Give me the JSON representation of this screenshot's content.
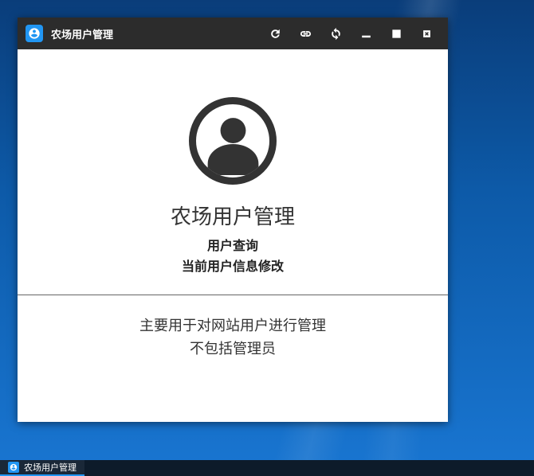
{
  "window": {
    "title": "农场用户管理"
  },
  "content": {
    "heading": "农场用户管理",
    "link1": "用户查询",
    "link2": "当前用户信息修改",
    "desc1": "主要用于对网站用户进行管理",
    "desc2": "不包括管理员"
  },
  "taskbar": {
    "item1": "农场用户管理"
  }
}
